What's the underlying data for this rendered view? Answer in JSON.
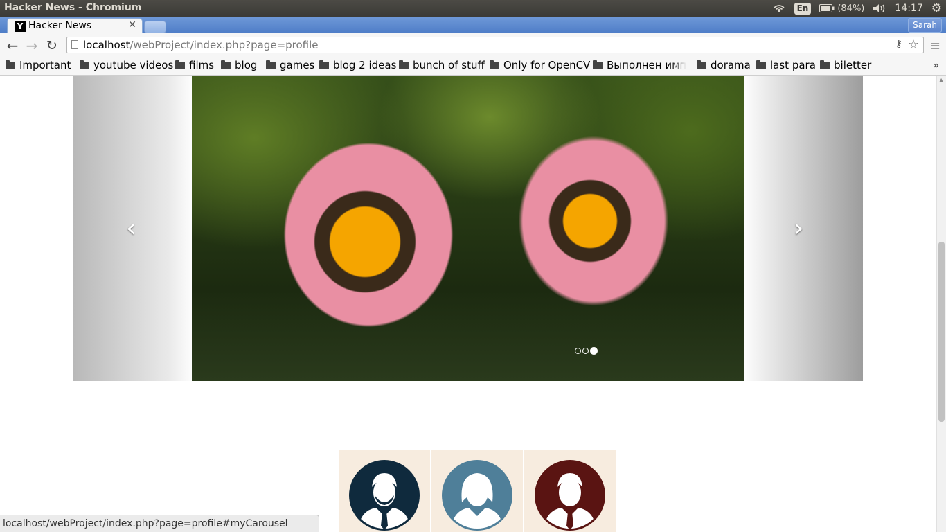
{
  "os_panel": {
    "window_title": "Hacker News - Chromium",
    "keyboard_layout": "En",
    "battery": "(84%)",
    "time": "14:17"
  },
  "browser": {
    "tab": {
      "favicon_letter": "Y",
      "title": "Hacker News"
    },
    "profile_name": "Sarah",
    "url": {
      "host": "localhost",
      "path": "/webProject/index.php?page=profile"
    },
    "bookmarks": [
      {
        "label": "Important"
      },
      {
        "label": "youtube videos"
      },
      {
        "label": "films"
      },
      {
        "label": "blog"
      },
      {
        "label": "games"
      },
      {
        "label": "blog 2 ideas"
      },
      {
        "label": "bunch of stuff"
      },
      {
        "label": "Only for OpenCV"
      },
      {
        "label": "Выполнен импо"
      },
      {
        "label": "dorama"
      },
      {
        "label": "last para"
      },
      {
        "label": "biletter"
      }
    ],
    "bookmarks_more": "»"
  },
  "page": {
    "carousel": {
      "prev_glyph": "‹",
      "next_glyph": "›",
      "slide_count": 3,
      "active_index": 2
    },
    "avatars": [
      {
        "kind": "man-beard",
        "color": "#0f2a3d"
      },
      {
        "kind": "woman",
        "color": "#4f7f99"
      },
      {
        "kind": "man",
        "color": "#5a1412"
      }
    ]
  },
  "status_url": "localhost/webProject/index.php?page=profile#myCarousel"
}
